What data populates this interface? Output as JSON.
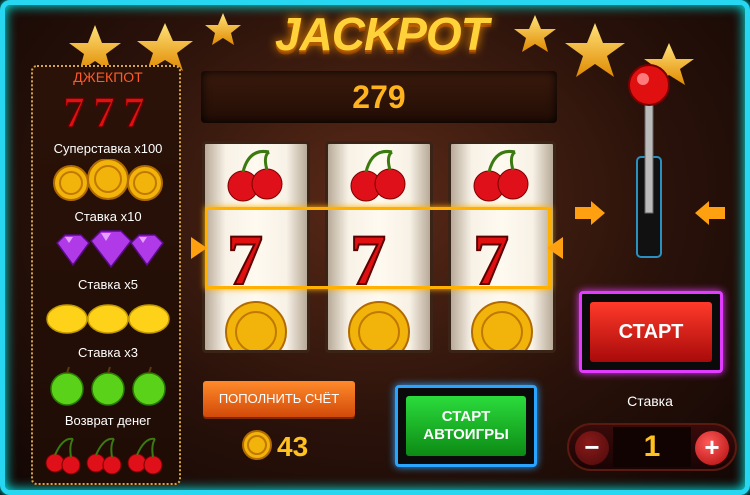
{
  "title": "JACKPOT",
  "counter": "279",
  "paytable": {
    "jackpot_label": "ДЖЕКПОТ",
    "jackpot_symbol": "777",
    "rows": [
      {
        "label": "Суперставка x100",
        "symbol": "coin"
      },
      {
        "label": "Ставка x10",
        "symbol": "gem"
      },
      {
        "label": "Ставка x5",
        "symbol": "lemon"
      },
      {
        "label": "Ставка x3",
        "symbol": "apple"
      },
      {
        "label": "Возврат денег",
        "symbol": "cherry"
      }
    ]
  },
  "reels": [
    [
      "cherry",
      "seven",
      "coin"
    ],
    [
      "cherry",
      "seven",
      "coin"
    ],
    [
      "cherry",
      "seven",
      "coin"
    ]
  ],
  "buttons": {
    "deposit": "ПОПОЛНИТЬ СЧЁТ",
    "auto_line1": "СТАРТ",
    "auto_line2": "АВТОИГРЫ",
    "start": "СТАРТ"
  },
  "balance": "43",
  "bet": {
    "label": "Ставка",
    "value": "1",
    "minus": "−",
    "plus": "+"
  },
  "colors": {
    "frame": "#27d6f0",
    "gold": "#ffc21e",
    "payline": "#ffb000"
  }
}
